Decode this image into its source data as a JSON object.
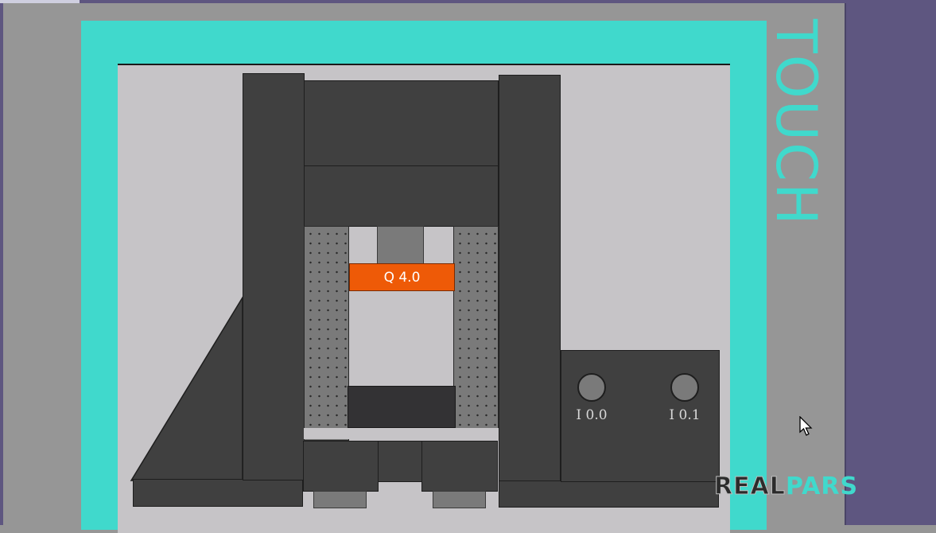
{
  "panel": {
    "brand_text": "TOUCH",
    "frame_color": "#40d9cc",
    "side_color": "#5e5680"
  },
  "hmi": {
    "output_label": "Q 4.0",
    "output_color": "#ee5a07",
    "inputs": [
      {
        "label": "I 0.0",
        "icon": "indicator-lamp-icon"
      },
      {
        "label": "I 0.1",
        "icon": "indicator-lamp-icon"
      }
    ]
  },
  "watermark": {
    "part1": "REAL",
    "part2": "PARS"
  },
  "cursor": {
    "icon": "mouse-pointer-icon"
  }
}
